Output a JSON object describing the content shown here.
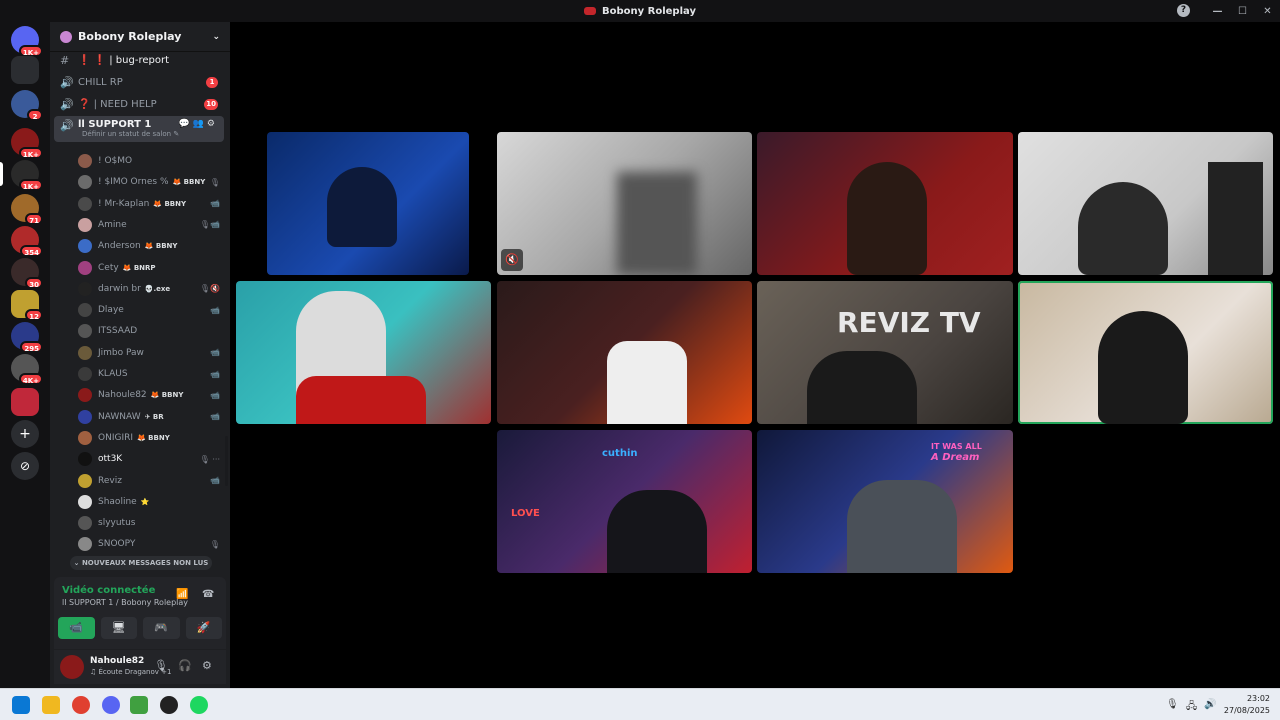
{
  "window": {
    "title": "Bobony Roleplay",
    "minimize": "—",
    "maximize": "☐",
    "close": "✕",
    "help": "?"
  },
  "rail": {
    "badges": [
      "1K+",
      "2",
      "1K+",
      "1K+",
      "71",
      "354",
      "30",
      "12",
      "295",
      "4K+"
    ],
    "add": "+",
    "explore": "⊘"
  },
  "server": {
    "name": "Bobony Roleplay",
    "chevron": "⌄"
  },
  "channels": [
    {
      "icon": "#",
      "name": "❗ ❗ | bug-report",
      "badge": ""
    },
    {
      "icon": "🔊",
      "name": "CHILL RP",
      "badge": "1"
    },
    {
      "icon": "🔊",
      "name": "❓ | NEED HELP",
      "badge": "10"
    }
  ],
  "active_channel": {
    "icon": "🔊",
    "name": "ll SUPPORT 1",
    "status": "Définir un statut de salon ✎",
    "actions": "💬👥⚙"
  },
  "members": [
    {
      "name": "! O$MO",
      "tag": "",
      "icon": "",
      "color": "#8b5a4a"
    },
    {
      "name": "! $IMO Ornes %",
      "tag": "🦊 BBNY",
      "icon": "🎙",
      "color": "#6b6b6b"
    },
    {
      "name": "! Mr-Kaplan",
      "tag": "🦊 BBNY",
      "icon": "📹",
      "color": "#4a4a4a"
    },
    {
      "name": "Amine",
      "tag": "",
      "icon": "🎙📹",
      "color": "#c9a0a0"
    },
    {
      "name": "Anderson",
      "tag": "🦊 BBNY",
      "icon": "",
      "color": "#3b6cc7"
    },
    {
      "name": "Cety",
      "tag": "🦊 BNRP",
      "icon": "",
      "color": "#a04080"
    },
    {
      "name": "darwin br",
      "tag": "💀.exe",
      "icon": "🎙🔇",
      "color": "#222222"
    },
    {
      "name": "Dlaye",
      "tag": "",
      "icon": "📹",
      "color": "#444444"
    },
    {
      "name": "ITSSAAD",
      "tag": "",
      "icon": "",
      "color": "#555555"
    },
    {
      "name": "Jimbo Paw",
      "tag": "",
      "icon": "📹",
      "color": "#6a5a3a"
    },
    {
      "name": "KLAUS",
      "tag": "",
      "icon": "📹",
      "color": "#3a3a3a"
    },
    {
      "name": "Nahoule82",
      "tag": "🦊 BBNY",
      "icon": "📹",
      "color": "#8a1a1a"
    },
    {
      "name": "NAWNAW",
      "tag": "✈ BR",
      "icon": "📹",
      "color": "#3040a0"
    },
    {
      "name": "ONIGIRI",
      "tag": "🦊 BBNY",
      "icon": "",
      "color": "#a06040"
    },
    {
      "name": "ott3K",
      "tag": "",
      "icon": "🎙 ···",
      "color": "#111111"
    },
    {
      "name": "Reviz",
      "tag": "",
      "icon": "📹",
      "color": "#c0a030"
    },
    {
      "name": "Shaoline",
      "tag": "⭐",
      "icon": "",
      "color": "#dddddd"
    },
    {
      "name": "slyyutus",
      "tag": "",
      "icon": "",
      "color": "#555555"
    },
    {
      "name": "SNOOPY",
      "tag": "",
      "icon": "🎙",
      "color": "#888888"
    }
  ],
  "new_messages": "⌄ NOUVEAUX MESSAGES NON LUS",
  "voice": {
    "title": "Vidéo connectée",
    "subtitle": "ll SUPPORT 1 / Bobony Roleplay",
    "buttons": [
      "📹",
      "🖥",
      "🎮",
      "🚀"
    ],
    "signal_icon": "📶",
    "disconnect_icon": "☎"
  },
  "user": {
    "name": "Nahoule82",
    "status": "♫ Écoute Draganov +1",
    "mic": "🎙",
    "headset": "🎧",
    "settings": "⚙"
  },
  "stage_text": {
    "reviz": "REVIZ TV",
    "dream_top": "IT WAS ALL",
    "dream_bottom": "A Dream",
    "neon": "cuthin",
    "love": "LOVE",
    "mute_icon": "🔇"
  },
  "clock": {
    "time": "23:02",
    "date": "27/08/2025"
  },
  "tray": {
    "mic": "🎙",
    "net": "🖧",
    "vol": "🔊"
  }
}
